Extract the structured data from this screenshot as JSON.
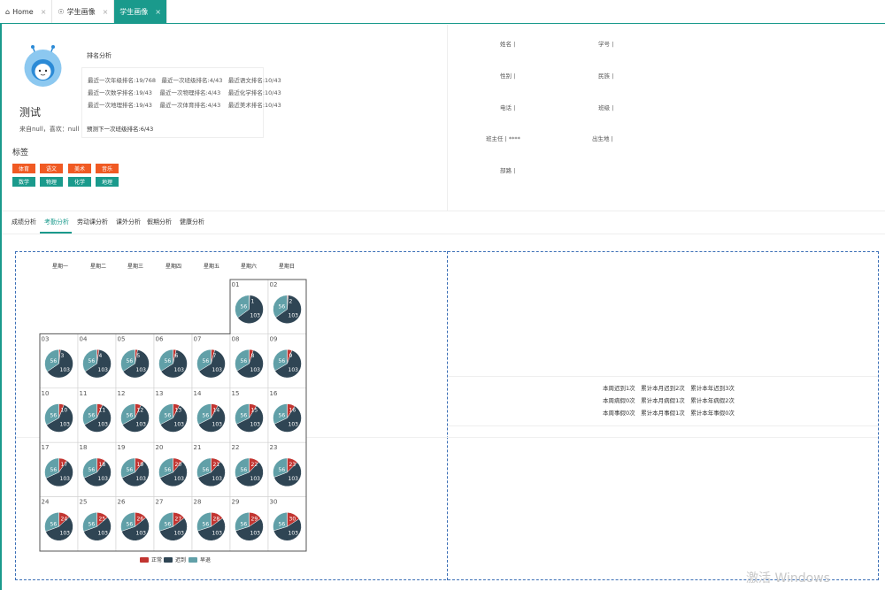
{
  "tabs": [
    {
      "label": "Home",
      "icon": "home-icon"
    },
    {
      "label": "学生画像",
      "icon": "dashboard-icon"
    },
    {
      "label": "学生画像",
      "icon": ""
    }
  ],
  "profile": {
    "name": "测试",
    "source": "来自null，喜欢：null",
    "tags_title": "标签",
    "tags_orange": [
      "体育",
      "语文",
      "美术",
      "音乐"
    ],
    "tags_green": [
      "数学",
      "物理",
      "化学",
      "地理"
    ]
  },
  "ranking": {
    "title": "排名分析",
    "rows": [
      "最近一次年级排名:19/768　最近一次班级排名:4/43　最近语文排名:10/43",
      "最近一次数学排名:19/43　 最近一次物理排名:4/43　 最近化学排名:10/43",
      "最近一次地理排名:19/43　 最近一次体育排名:4/43　 最近美术排名:10/43"
    ],
    "predict": "预测下一次班级排名:6/43"
  },
  "info": {
    "name_label": "姓名 |",
    "id_label": "学号 |",
    "gender_label": "性别 |",
    "ethnicity_label": "民族 |",
    "phone_label": "电话 |",
    "class_label": "班级 |",
    "teacher_label": "班主任 | ****",
    "birthplace_label": "出生地 |",
    "dorm_label": "部路 |"
  },
  "subtabs": [
    "成绩分析",
    "考勤分析",
    "劳动课分析",
    "课外分析",
    "假期分析",
    "健康分析"
  ],
  "active_subtab": "考勤分析",
  "weekdays": [
    "星期一",
    "星期二",
    "星期三",
    "星期四",
    "星期五",
    "星期六",
    "星期日"
  ],
  "calendar": {
    "first_weekday_index": 5,
    "days": 30,
    "normal_value": 56,
    "late_value": 103,
    "colors": {
      "absent": "#c23531",
      "late": "#2f4554",
      "normal": "#61a0a8"
    }
  },
  "legend": [
    {
      "label": "正常",
      "color": "#c23531"
    },
    {
      "label": "迟到",
      "color": "#2f4554"
    },
    {
      "label": "早退",
      "color": "#61a0a8"
    }
  ],
  "stats": [
    "本周迟到1次　累计本月迟到2次　累计本年迟到3次",
    "本周病假0次　累计本月病假1次　累计本年病假2次",
    "本周事假0次　累计本月事假1次　累计本年事假0次"
  ],
  "watermark": "激活 Windows"
}
